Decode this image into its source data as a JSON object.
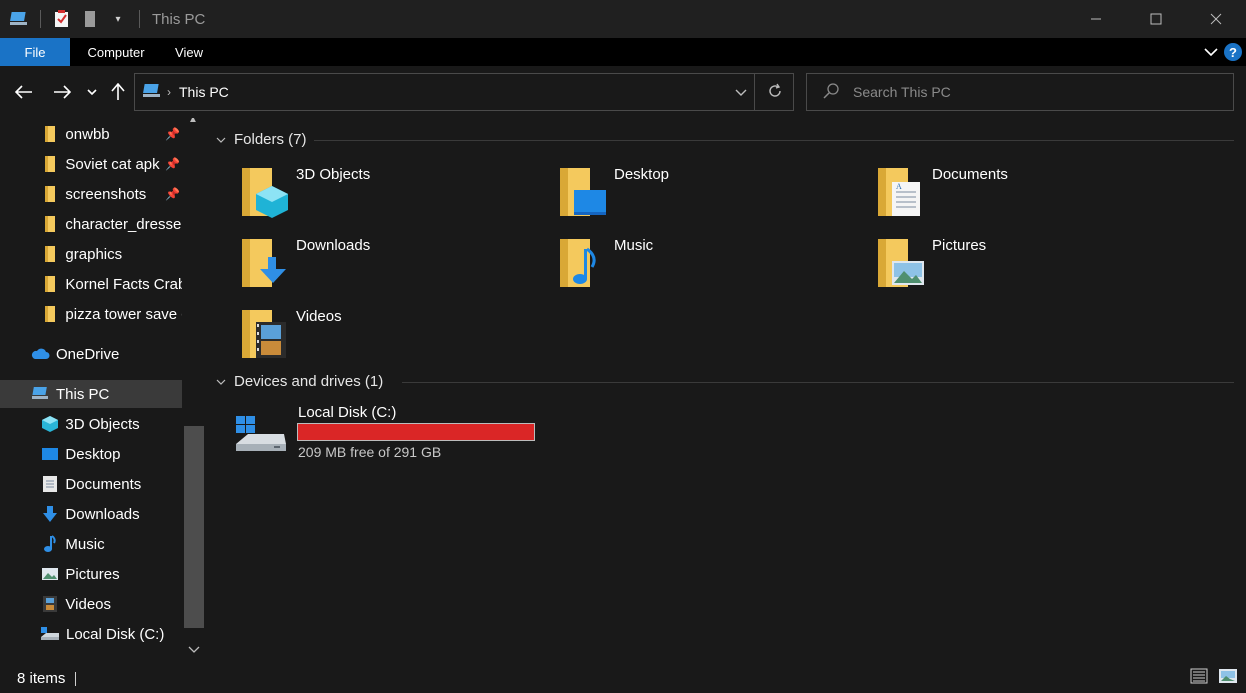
{
  "window": {
    "title": "This PC"
  },
  "ribbon": {
    "tabs": [
      "File",
      "Computer",
      "View"
    ],
    "help": "?"
  },
  "nav": {
    "address_path": "This PC",
    "search_placeholder": "Search This PC"
  },
  "sidebar": {
    "quick_access": [
      {
        "label": "onwbb",
        "pinned": true
      },
      {
        "label": "Soviet cat apk",
        "pinned": true
      },
      {
        "label": "screenshots",
        "pinned": true
      },
      {
        "label": "character_dresser_",
        "pinned": false
      },
      {
        "label": "graphics",
        "pinned": false
      },
      {
        "label": "Kornel Facts Crab",
        "pinned": false
      },
      {
        "label": "pizza tower save c",
        "pinned": false
      }
    ],
    "onedrive": "OneDrive",
    "this_pc": "This PC",
    "pc_items": [
      "3D Objects",
      "Desktop",
      "Documents",
      "Downloads",
      "Music",
      "Pictures",
      "Videos",
      "Local Disk (C:)"
    ]
  },
  "main": {
    "folders_header": "Folders (7)",
    "folders": [
      "3D Objects",
      "Desktop",
      "Documents",
      "Downloads",
      "Music",
      "Pictures",
      "Videos"
    ],
    "devices_header": "Devices and drives (1)",
    "drive": {
      "name": "Local Disk (C:)",
      "free_text": "209 MB free of 291 GB",
      "used_fraction": 0.9993
    }
  },
  "status": {
    "items": "8 items"
  },
  "colors": {
    "accent": "#1a73c6",
    "drive_full": "#da2626",
    "folder": "#f4c95d"
  }
}
